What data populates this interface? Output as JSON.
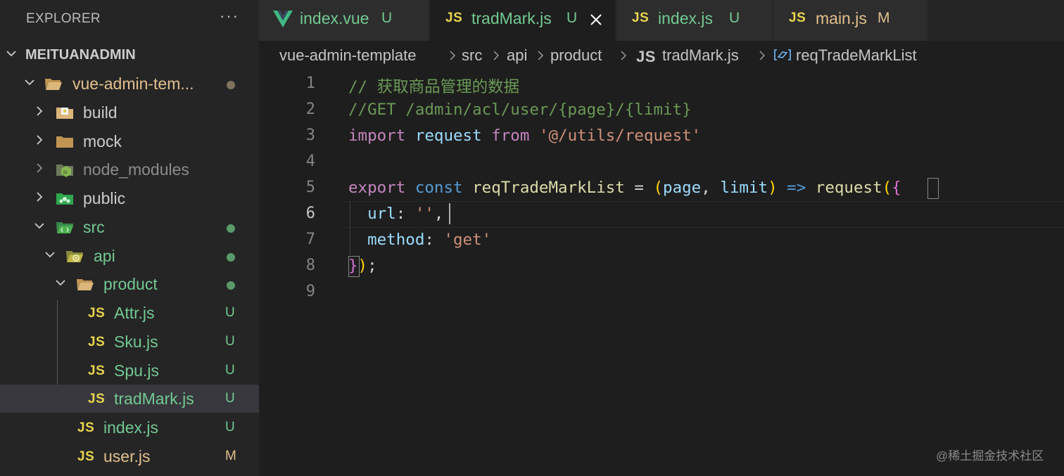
{
  "colors": {
    "sidebar_bg": "#252526",
    "editor_bg": "#1e1e1e",
    "untracked": "#73c991",
    "modified": "#e2c08d",
    "js_icon": "#e8d44d",
    "vue_icon": "#41b883"
  },
  "sidebar": {
    "title": "EXPLORER",
    "more_icon": "ellipsis-icon",
    "root": "MEITUANADMIN",
    "items": [
      {
        "label": "vue-admin-tem...",
        "icon": "folder-open-icon",
        "status": "dot",
        "color": "#e2c08d"
      },
      {
        "label": "build",
        "icon": "folder-build-icon",
        "status": "",
        "color": "#cccccc"
      },
      {
        "label": "mock",
        "icon": "folder-icon",
        "status": "",
        "color": "#cccccc"
      },
      {
        "label": "node_modules",
        "icon": "folder-node-icon",
        "status": "",
        "color": "#8c8c8c"
      },
      {
        "label": "public",
        "icon": "folder-public-icon",
        "status": "",
        "color": "#cccccc"
      },
      {
        "label": "src",
        "icon": "folder-src-icon",
        "status": "dot",
        "color": "#73c991"
      },
      {
        "label": "api",
        "icon": "folder-api-icon",
        "status": "dot",
        "color": "#73c991"
      },
      {
        "label": "product",
        "icon": "folder-open-icon",
        "status": "dot",
        "color": "#73c991"
      },
      {
        "label": "Attr.js",
        "icon": "js-file-icon",
        "status": "U",
        "color": "#73c991"
      },
      {
        "label": "Sku.js",
        "icon": "js-file-icon",
        "status": "U",
        "color": "#73c991"
      },
      {
        "label": "Spu.js",
        "icon": "js-file-icon",
        "status": "U",
        "color": "#73c991"
      },
      {
        "label": "tradMark.js",
        "icon": "js-file-icon",
        "status": "U",
        "color": "#73c991"
      },
      {
        "label": "index.js",
        "icon": "js-file-icon",
        "status": "U",
        "color": "#73c991"
      },
      {
        "label": "user.js",
        "icon": "js-file-icon",
        "status": "M",
        "color": "#e2c08d"
      }
    ]
  },
  "tabs": [
    {
      "label": "index.vue",
      "status": "U",
      "icon": "vue-icon"
    },
    {
      "label": "tradMark.js",
      "status": "U",
      "icon": "js-file-icon",
      "active": true
    },
    {
      "label": "index.js",
      "status": "U",
      "icon": "js-file-icon"
    },
    {
      "label": "main.js",
      "status": "M",
      "icon": "js-file-icon"
    }
  ],
  "js_glyph": "JS",
  "breadcrumb": {
    "parts": [
      "vue-admin-template",
      "src",
      "api",
      "product",
      "tradMark.js",
      "reqTradeMarkList"
    ]
  },
  "editor": {
    "line_numbers": [
      "1",
      "2",
      "3",
      "4",
      "5",
      "6",
      "7",
      "8",
      "9"
    ],
    "current_line": "6",
    "lines": [
      [
        {
          "t": "// 获取商品管理的数据",
          "c": "tok-comment"
        }
      ],
      [
        {
          "t": "//GET /admin/acl/user/{page}/{limit}",
          "c": "tok-comment"
        }
      ],
      [
        {
          "t": "import",
          "c": "tok-keyword"
        },
        {
          "t": " ",
          "c": "tok-plain"
        },
        {
          "t": "request",
          "c": "tok-var"
        },
        {
          "t": " ",
          "c": "tok-plain"
        },
        {
          "t": "from",
          "c": "tok-keyword"
        },
        {
          "t": " ",
          "c": "tok-plain"
        },
        {
          "t": "'@/utils/request'",
          "c": "tok-string"
        }
      ],
      [],
      [
        {
          "t": "export",
          "c": "tok-keyword"
        },
        {
          "t": " ",
          "c": "tok-plain"
        },
        {
          "t": "const",
          "c": "tok-storage"
        },
        {
          "t": " ",
          "c": "tok-plain"
        },
        {
          "t": "reqTradeMarkList",
          "c": "tok-fn"
        },
        {
          "t": " = ",
          "c": "tok-plain"
        },
        {
          "t": "(",
          "c": "tok-paren"
        },
        {
          "t": "page",
          "c": "tok-param"
        },
        {
          "t": ", ",
          "c": "tok-plain"
        },
        {
          "t": "limit",
          "c": "tok-param"
        },
        {
          "t": ")",
          "c": "tok-paren"
        },
        {
          "t": " ",
          "c": "tok-plain"
        },
        {
          "t": "=>",
          "c": "tok-storage"
        },
        {
          "t": " ",
          "c": "tok-plain"
        },
        {
          "t": "request",
          "c": "tok-fn"
        },
        {
          "t": "(",
          "c": "tok-paren"
        },
        {
          "t": "{",
          "c": "tok-brace"
        }
      ],
      [
        {
          "t": "  ",
          "c": "tok-plain"
        },
        {
          "t": "url",
          "c": "tok-var"
        },
        {
          "t": ": ",
          "c": "tok-plain"
        },
        {
          "t": "''",
          "c": "tok-string"
        },
        {
          "t": ",",
          "c": "tok-plain"
        }
      ],
      [
        {
          "t": "  ",
          "c": "tok-plain"
        },
        {
          "t": "method",
          "c": "tok-var"
        },
        {
          "t": ": ",
          "c": "tok-plain"
        },
        {
          "t": "'get'",
          "c": "tok-string"
        }
      ],
      [
        {
          "t": "}",
          "c": "tok-brace"
        },
        {
          "t": ")",
          "c": "tok-paren"
        },
        {
          "t": ";",
          "c": "tok-plain"
        }
      ],
      []
    ]
  },
  "watermark": "@稀土掘金技术社区"
}
